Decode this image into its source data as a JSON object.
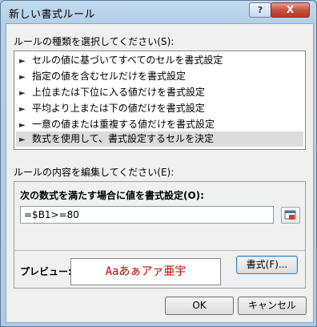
{
  "window": {
    "title": "新しい書式ルール",
    "help_label": "?",
    "close_label": "X"
  },
  "rule_type": {
    "label": "ルールの種類を選択してください(S):",
    "items": [
      "セルの値に基づいてすべてのセルを書式設定",
      "指定の値を含むセルだけを書式設定",
      "上位または下位に入る値だけを書式設定",
      "平均より上または下の値だけを書式設定",
      "一意の値または重複する値だけを書式設定",
      "数式を使用して、書式設定するセルを決定"
    ],
    "selected_index": 5
  },
  "rule_edit": {
    "label": "ルールの内容を編集してください(E):",
    "formula_label": "次の数式を満たす場合に値を書式設定(O):",
    "formula_value": "=$B1>=80",
    "preview_label": "プレビュー:",
    "preview_text": "Aaあぁアァ亜宇",
    "preview_color": "#c00000",
    "format_button": "書式(F)..."
  },
  "buttons": {
    "ok": "OK",
    "cancel": "キャンセル"
  }
}
